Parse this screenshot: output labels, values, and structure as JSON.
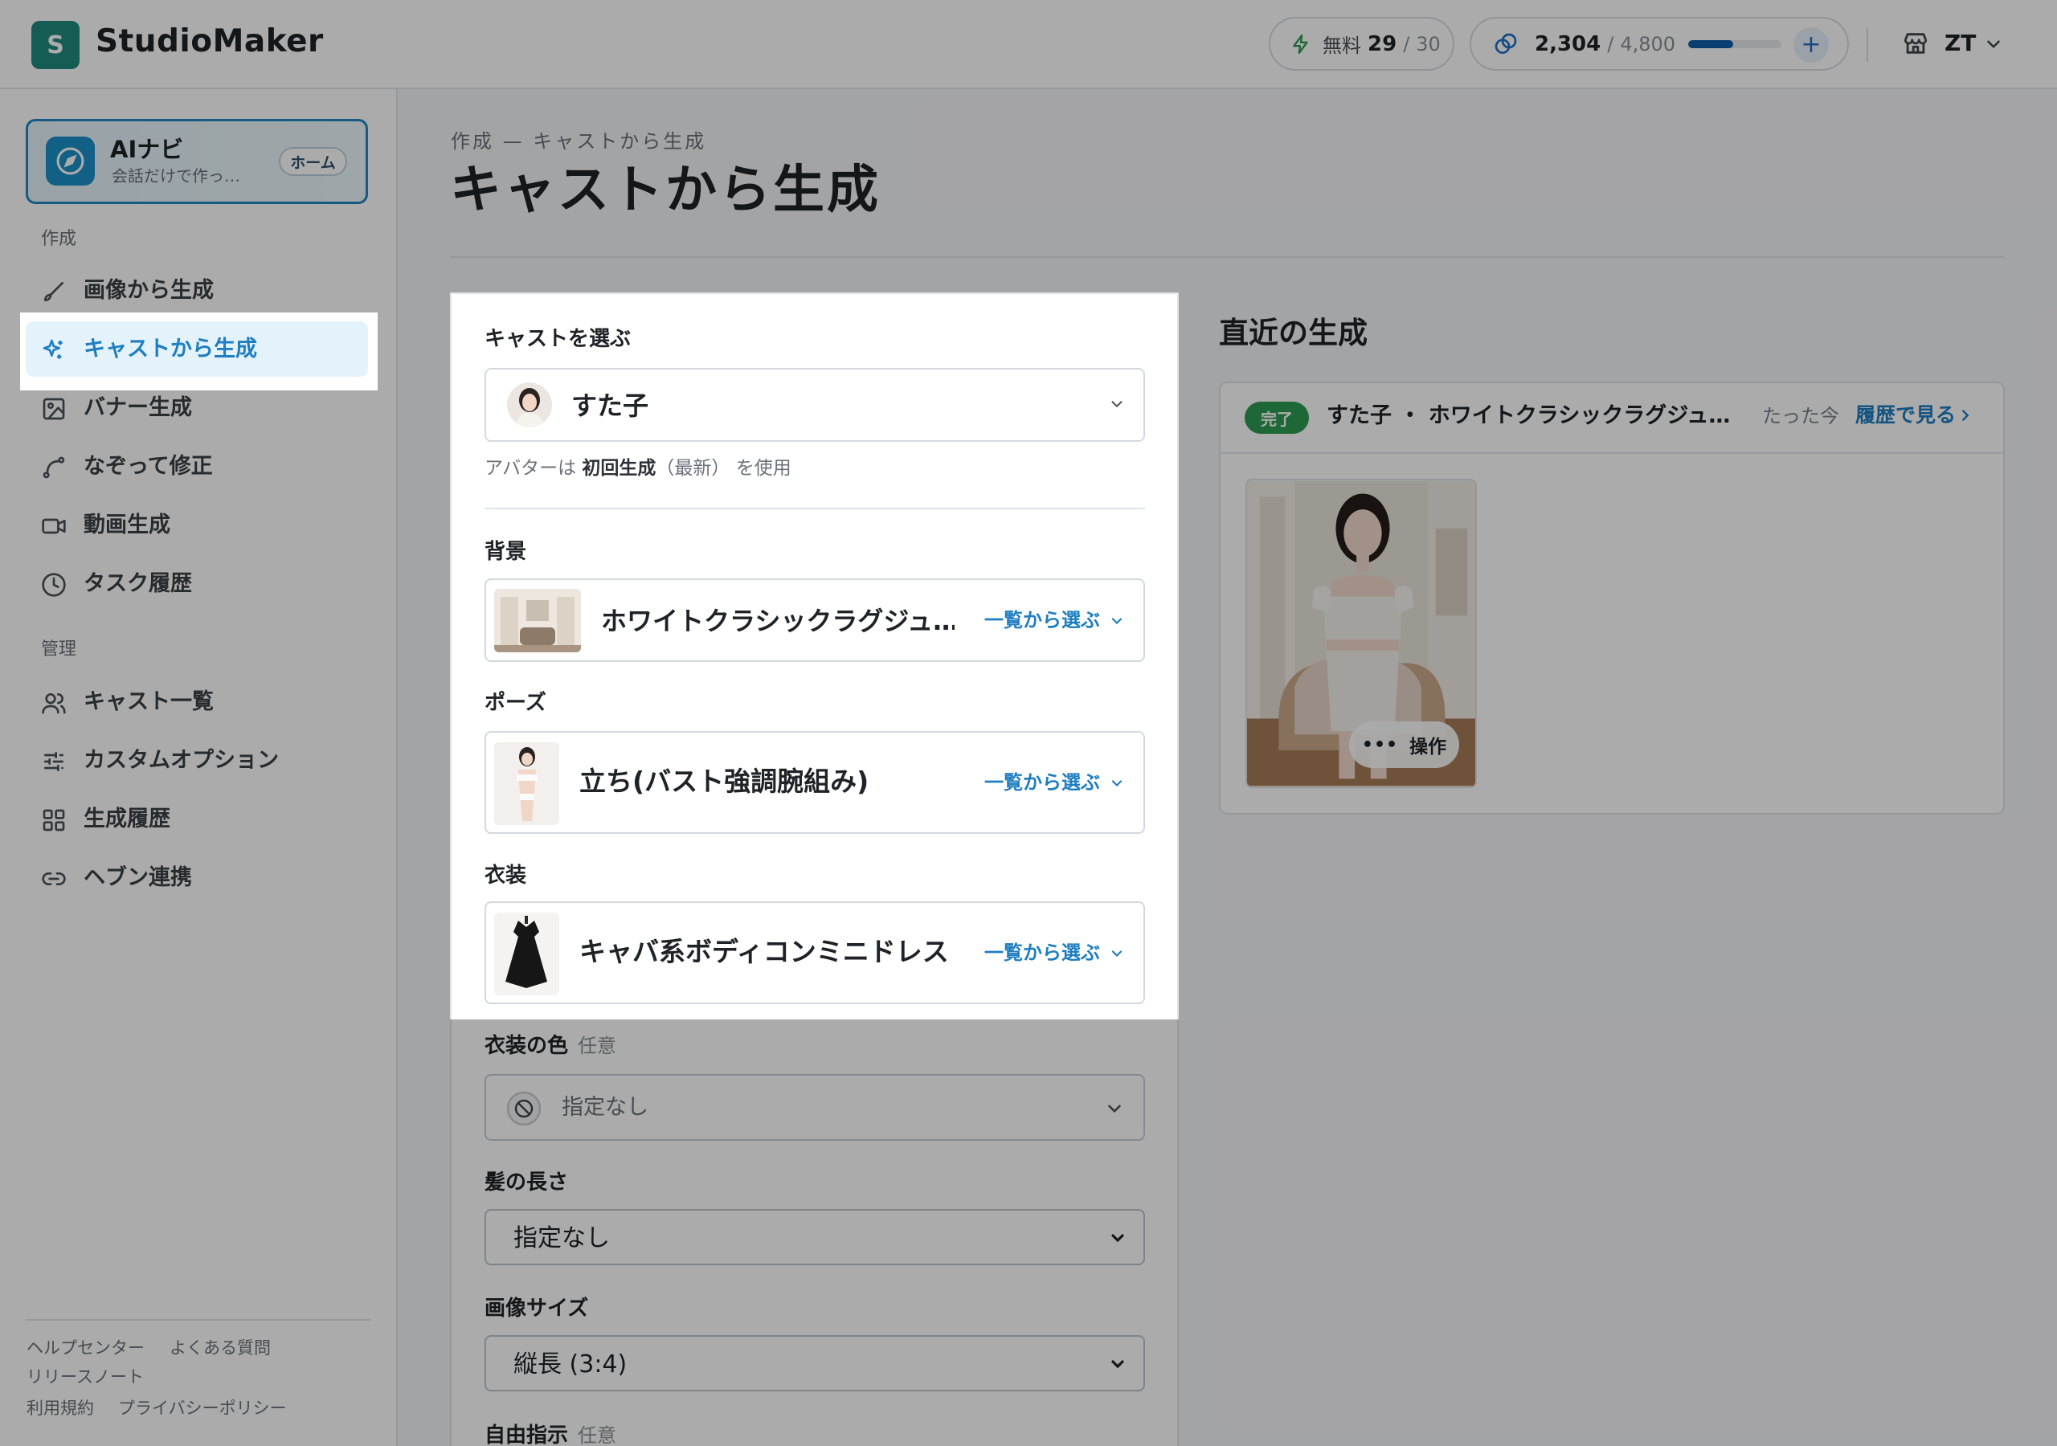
{
  "app": {
    "logo_letter": "S",
    "name": "StudioMaker"
  },
  "header": {
    "free": {
      "label": "無料",
      "used": "29",
      "sep": "/",
      "total": "30"
    },
    "credits": {
      "value": "2,304",
      "sep": "/",
      "total": "4,800",
      "fill_fraction": 0.48
    },
    "user": {
      "initials": "ZT"
    }
  },
  "sidebar": {
    "ai_nav": {
      "title": "AIナビ",
      "subtitle": "会話だけで作っ…",
      "badge": "ホーム"
    },
    "section_create": "作成",
    "create_items": [
      {
        "label": "画像から生成",
        "icon": "brush-icon"
      },
      {
        "label": "キャストから生成",
        "icon": "sparkle-icon",
        "active": true
      },
      {
        "label": "バナー生成",
        "icon": "image-icon"
      },
      {
        "label": "なぞって修正",
        "icon": "trace-icon"
      },
      {
        "label": "動画生成",
        "icon": "video-icon"
      },
      {
        "label": "タスク履歴",
        "icon": "clock-icon"
      }
    ],
    "section_manage": "管理",
    "manage_items": [
      {
        "label": "キャスト一覧",
        "icon": "users-icon"
      },
      {
        "label": "カスタムオプション",
        "icon": "sliders-icon"
      },
      {
        "label": "生成履歴",
        "icon": "grid-icon"
      },
      {
        "label": "ヘブン連携",
        "icon": "link-icon"
      }
    ],
    "footer": {
      "help": "ヘルプセンター",
      "faq": "よくある質問",
      "release": "リリースノート",
      "terms": "利用規約",
      "privacy": "プライバシーポリシー"
    }
  },
  "main": {
    "breadcrumb": "作成 — キャストから生成",
    "title": "キャストから生成",
    "form": {
      "cast_label": "キャストを選ぶ",
      "cast_value": "すた子",
      "avatar_note": {
        "prefix": "アバターは",
        "bold": "初回生成",
        "mid": "（最新）",
        "suffix": "を使用"
      },
      "background_label": "背景",
      "background_value": "ホワイトクラシックラグジュ…",
      "pose_label": "ポーズ",
      "pose_value": "立ち(バスト強調腕組み)",
      "outfit_label": "衣装",
      "outfit_value": "キャバ系ボディコンミニドレス",
      "pick_from_list": "一覧から選ぶ",
      "outfit_color_label": "衣装の色",
      "optional": "任意",
      "outfit_color_value": "指定なし",
      "hair_label": "髪の長さ",
      "hair_value": "指定なし",
      "size_label": "画像サイズ",
      "size_value": "縦長 (3:4)",
      "free_label": "自由指示"
    },
    "recent": {
      "title": "直近の生成",
      "status": "完了",
      "name": "すた子 ・ ホワイトクラシックラグジュ…",
      "time": "たった今",
      "history_link": "履歴で見る",
      "ops_label": "操作"
    }
  },
  "colors": {
    "brand": "#20897e",
    "accent": "#1f7ec0",
    "success": "#2d9a52",
    "credit_bar": "#0e5fa8"
  }
}
